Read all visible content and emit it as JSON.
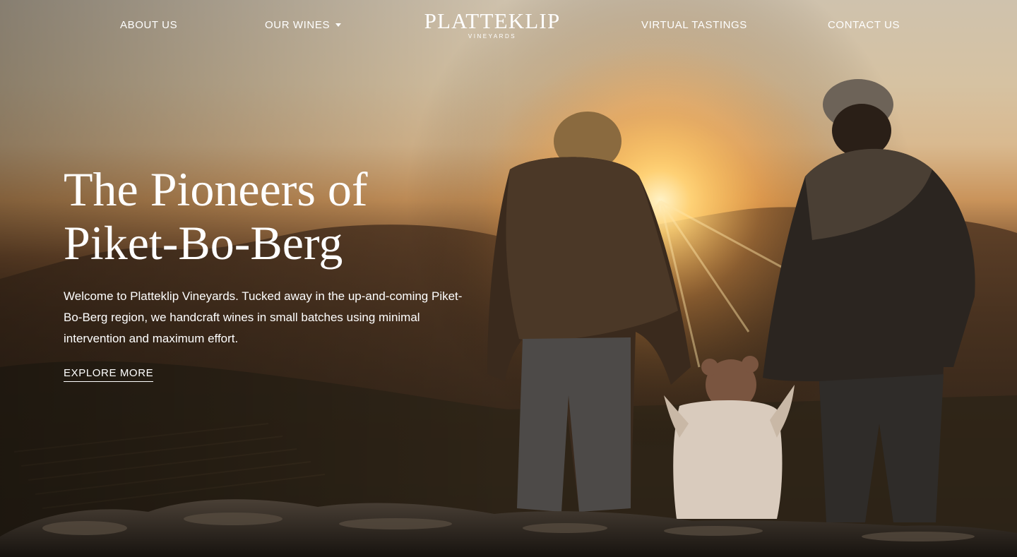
{
  "nav": {
    "about_label": "ABOUT US",
    "wines_label": "OUR WINES",
    "virtual_label": "VIRTUAL TASTINGS",
    "contact_label": "CONTACT US"
  },
  "logo": {
    "name": "PLATTEKLIP",
    "sub": "VINEYARDS"
  },
  "hero": {
    "headline_line1": "The Pioneers of",
    "headline_line2": "Piket-Bo-Berg",
    "intro": "Welcome to Platteklip Vineyards. Tucked away in the up-and-coming Piket-Bo-Berg region, we handcraft wines in small batches using minimal intervention and maximum effort.",
    "cta_label": "EXPLORE MORE"
  },
  "icons": {
    "dropdown": "chevron-down-icon"
  },
  "colors": {
    "text": "#ffffff",
    "sun": "#ffd98a",
    "sky": "#d6c2a2",
    "ground": "#2b2116"
  }
}
